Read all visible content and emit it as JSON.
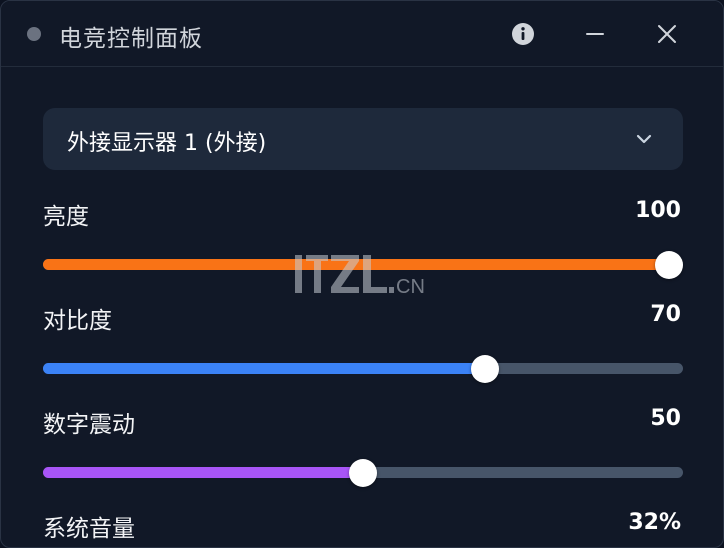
{
  "window": {
    "title": "电竞控制面板",
    "icons": {
      "info": "info-icon",
      "minimize": "minimize-icon",
      "close": "close-icon"
    }
  },
  "display_selector": {
    "selected": "外接显示器 1 (外接)",
    "icon": "chevron-down-icon"
  },
  "controls": [
    {
      "label": "亮度",
      "value_text": "100",
      "value": 100,
      "max": 100,
      "color": "#f97316"
    },
    {
      "label": "对比度",
      "value_text": "70",
      "value": 70,
      "max": 100,
      "color": "#3b82f6"
    },
    {
      "label": "数字震动",
      "value_text": "50",
      "value": 50,
      "max": 100,
      "color": "#a855f7"
    },
    {
      "label": "系统音量",
      "value_text": "32%",
      "value": 32,
      "max": 100,
      "color": "#22c55e"
    }
  ],
  "watermark": {
    "text": "ITZI.CN"
  },
  "colors": {
    "background": "#111827",
    "panel": "#1e293b",
    "track": "#475569"
  }
}
